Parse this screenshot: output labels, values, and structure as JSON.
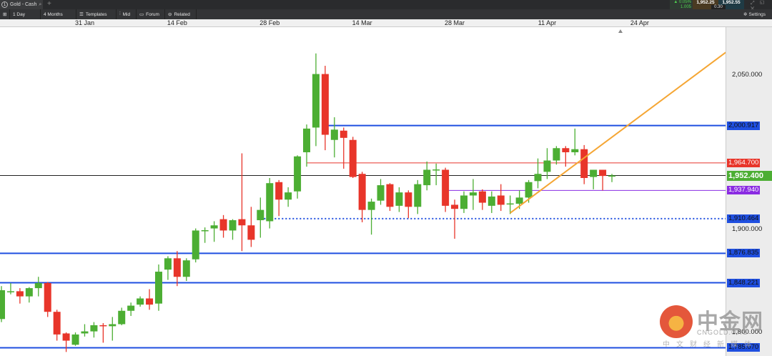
{
  "window": {
    "tab_number": "1",
    "tab_title": "Gold - Cash",
    "add_tab": "+"
  },
  "quote": {
    "change_pct": "▲ 0.05%",
    "change_abs": "1.005",
    "bid": "1,952.25",
    "ask": "1,952.55",
    "spread": "0.30",
    "window_controls": "⤢ ◱ ✕"
  },
  "toolbar": {
    "items": [
      {
        "label": "1 Day"
      },
      {
        "label": "4 Months"
      },
      {
        "label": "Templates"
      },
      {
        "label": "Mid"
      },
      {
        "label": "Forum"
      },
      {
        "label": "Related"
      }
    ],
    "settings": "Settings"
  },
  "date_axis": [
    {
      "label": "31 Jan",
      "candle": 10
    },
    {
      "label": "14 Feb",
      "candle": 20
    },
    {
      "label": "28 Feb",
      "candle": 30
    },
    {
      "label": "14 Mar",
      "candle": 40
    },
    {
      "label": "28 Mar",
      "candle": 50
    },
    {
      "label": "11 Apr",
      "candle": 60
    },
    {
      "label": "24 Apr",
      "candle": 70
    }
  ],
  "price_axis": {
    "ticks": [
      {
        "label": "2,050.000",
        "value": 2050
      },
      {
        "label": "1,900.000",
        "value": 1900
      },
      {
        "label": "1,800.000",
        "value": 1800
      }
    ]
  },
  "current_price": {
    "label": "1,952.400",
    "value": 1952.4,
    "color": "#4cae33"
  },
  "levels": [
    {
      "label": "2,000.917",
      "value": 2000.917,
      "color": "#1f4fe0",
      "style": "solid-thick",
      "from_candle": 36
    },
    {
      "label": "1,964.700",
      "value": 1964.7,
      "color": "#e8352a",
      "style": "thin",
      "from_candle": 34
    },
    {
      "label": "1,937.940",
      "value": 1937.94,
      "color": "#8a2be2",
      "style": "thin",
      "from_candle": 49
    },
    {
      "label": "1,910.464",
      "value": 1910.464,
      "color": "#1f4fe0",
      "style": "dotted",
      "from_candle": 29
    },
    {
      "label": "1,876.835",
      "value": 1876.835,
      "color": "#1f4fe0",
      "style": "solid-thick",
      "from_candle": 0
    },
    {
      "label": "1,848.221",
      "value": 1848.221,
      "color": "#1f4fe0",
      "style": "solid-thick",
      "from_candle": 0
    },
    {
      "label": "1,785.070",
      "value": 1785.07,
      "color": "#1f4fe0",
      "style": "solid-thick",
      "from_candle": 0
    }
  ],
  "trendline": {
    "color": "#f5a634",
    "start": {
      "candle": 56,
      "price": 1916
    },
    "end": {
      "candle": 79.3,
      "price": 2072
    }
  },
  "colors": {
    "up": "#4cae33",
    "down": "#e8352a"
  },
  "candles": [
    [
      1813,
      1845,
      1810,
      1841
    ],
    [
      1840,
      1848,
      1837,
      1840
    ],
    [
      1840,
      1843,
      1828,
      1835
    ],
    [
      1835,
      1844,
      1829,
      1843
    ],
    [
      1843,
      1854,
      1835,
      1848
    ],
    [
      1848,
      1849,
      1815,
      1820
    ],
    [
      1820,
      1822,
      1792,
      1798
    ],
    [
      1799,
      1800,
      1781,
      1792
    ],
    [
      1788,
      1800,
      1787,
      1798
    ],
    [
      1799,
      1808,
      1796,
      1801
    ],
    [
      1801,
      1810,
      1795,
      1807
    ],
    [
      1807,
      1809,
      1790,
      1806
    ],
    [
      1806,
      1815,
      1792,
      1808
    ],
    [
      1808,
      1824,
      1807,
      1821
    ],
    [
      1821,
      1829,
      1816,
      1826
    ],
    [
      1827,
      1835,
      1825,
      1833
    ],
    [
      1833,
      1842,
      1822,
      1827
    ],
    [
      1828,
      1866,
      1821,
      1859
    ],
    [
      1861,
      1874,
      1851,
      1872
    ],
    [
      1872,
      1879,
      1845,
      1854
    ],
    [
      1854,
      1872,
      1850,
      1870
    ],
    [
      1871,
      1901,
      1868,
      1899
    ],
    [
      1899,
      1902,
      1887,
      1899.3
    ],
    [
      1901,
      1908,
      1888,
      1904
    ],
    [
      1910,
      1914,
      1892,
      1899
    ],
    [
      1899,
      1910,
      1890,
      1909
    ],
    [
      1910,
      1974,
      1879,
      1904
    ],
    [
      1904,
      1922,
      1883,
      1890
    ],
    [
      1909,
      1931,
      1892,
      1919
    ],
    [
      1908,
      1950,
      1901,
      1945
    ],
    [
      1946,
      1948,
      1913,
      1929
    ],
    [
      1929,
      1941,
      1922,
      1936
    ],
    [
      1937,
      1972,
      1930,
      1971
    ],
    [
      1975,
      2002,
      1961,
      1998
    ],
    [
      1999,
      2071,
      1981,
      2051
    ],
    [
      2051,
      2059,
      1977,
      1992
    ],
    [
      1987,
      2009,
      1970,
      1997
    ],
    [
      1996,
      1999,
      1959,
      1989
    ],
    [
      1987,
      1990,
      1950,
      1951
    ],
    [
      1954,
      1956,
      1907,
      1919
    ],
    [
      1919,
      1930,
      1895,
      1927
    ],
    [
      1928,
      1949,
      1924,
      1943
    ],
    [
      1944,
      1945,
      1918,
      1922
    ],
    [
      1923,
      1941,
      1917,
      1936
    ],
    [
      1936,
      1938,
      1911,
      1922
    ],
    [
      1922,
      1948,
      1915,
      1944
    ],
    [
      1943,
      1966,
      1938,
      1958
    ],
    [
      1958,
      1964,
      1943,
      1958.3
    ],
    [
      1958,
      1960,
      1917,
      1923
    ],
    [
      1924,
      1929,
      1891,
      1920
    ],
    [
      1920,
      1937,
      1916,
      1933
    ],
    [
      1933,
      1949,
      1919,
      1936
    ],
    [
      1937,
      1939,
      1919,
      1926
    ],
    [
      1923,
      1937,
      1916,
      1932
    ],
    [
      1933,
      1944,
      1918,
      1924
    ],
    [
      1925,
      1933,
      1915,
      1925.3
    ],
    [
      1925,
      1938,
      1920,
      1931
    ],
    [
      1931,
      1948,
      1926,
      1946
    ],
    [
      1947,
      1969,
      1940,
      1954
    ],
    [
      1956,
      1979,
      1949,
      1967
    ],
    [
      1967,
      1981,
      1963,
      1979
    ],
    [
      1979,
      1981,
      1961,
      1975
    ],
    [
      1975,
      1998,
      1972,
      1978
    ],
    [
      1978,
      1982,
      1944,
      1950
    ],
    [
      1951,
      1958,
      1939,
      1958
    ],
    [
      1958,
      1958,
      1938,
      1952
    ],
    [
      1952,
      1954,
      1946,
      1952.4
    ]
  ],
  "watermark": {
    "name": "中金网",
    "domain": "CNGOLD.ORG",
    "slogan": "中文财经新媒体"
  }
}
